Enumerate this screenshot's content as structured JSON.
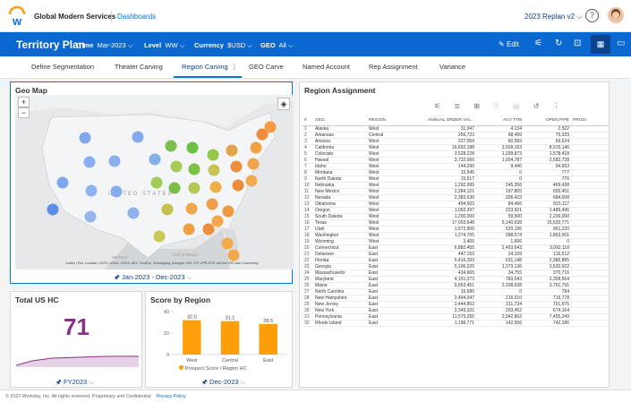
{
  "top": {
    "company": "Global Modern Services",
    "nav_link": "Dashboards",
    "plan": "2023 Replan v2",
    "help": "?"
  },
  "header": {
    "title": "Territory Plan",
    "filters": [
      {
        "label": "Time",
        "value": "Mar-2023"
      },
      {
        "label": "Level",
        "value": "WW"
      },
      {
        "label": "Currency",
        "value": "$USD"
      },
      {
        "label": "GEO",
        "value": "All"
      }
    ],
    "edit": "Edit"
  },
  "tabs": [
    "Define Segmentation",
    "Theater Carving",
    "Region Carving",
    "GEO Carve",
    "Named Account",
    "Rep Assignment",
    "Variance"
  ],
  "active_tab": "Region Carving",
  "geo_map": {
    "title": "Geo Map",
    "labels": {
      "country": "UNITED STATES",
      "mexico": "MEXICO",
      "gulf": "Gulf of Mexico"
    },
    "attribution": "Leaflet | Esri, Location, USGS, USDA, USGS, AEX, GeoEye, Getmapping, Aerogrid, IGN, IGP, UPR-EGP, and the GIS User Community",
    "period": "Jan-2023 - Dec-2023",
    "zoom_in": "+",
    "zoom_out": "−"
  },
  "total_hc": {
    "title": "Total US HC",
    "value": "71",
    "period": "FY2023"
  },
  "score": {
    "title": "Score by Region",
    "period": "Dec-2023"
  },
  "region_assignment": {
    "title": "Region Assignment",
    "columns": [
      "#",
      "GEO",
      "REGION",
      "ANNUAL ORDER VAL...",
      "ACV TTM",
      "OPEN PIPE",
      "PROSI"
    ],
    "rows": [
      [
        "1",
        "Alaska",
        "West",
        "31,947",
        "4,134",
        "2,522"
      ],
      [
        "2",
        "Arkansas",
        "Central",
        "256,723",
        "68,499",
        "75,329"
      ],
      [
        "3",
        "Arizona",
        "West",
        "227,059",
        "60,583",
        "66,624"
      ],
      [
        "4",
        "California",
        "West",
        "16,692,188",
        "3,509,153",
        "8,915,146"
      ],
      [
        "5",
        "Colorado",
        "West",
        "3,528,228",
        "1,299,873",
        "1,578,418"
      ],
      [
        "6",
        "Hawaii",
        "West",
        "3,732,066",
        "1,004,787",
        "2,582,738"
      ],
      [
        "7",
        "Idaho",
        "West",
        "144,290",
        "9,440",
        "94,663"
      ],
      [
        "8",
        "Montana",
        "West",
        "15,545",
        "0",
        "777"
      ],
      [
        "9",
        "North Dakota",
        "West",
        "15,517",
        "0",
        "776"
      ],
      [
        "10",
        "Nebraska",
        "West",
        "1,292,995",
        "245,356",
        "469,438"
      ],
      [
        "11",
        "New Mexico",
        "West",
        "2,284,121",
        "197,805",
        "655,451"
      ],
      [
        "12",
        "Nevada",
        "West",
        "2,383,636",
        "206,423",
        "684,008"
      ],
      [
        "13",
        "Oklahoma",
        "West",
        "494,503",
        "84,466",
        "815,117"
      ],
      [
        "14",
        "Oregon",
        "West",
        "1,092,297",
        "223,921",
        "1,489,496"
      ],
      [
        "15",
        "South Dakota",
        "West",
        "1,200,000",
        "59,500",
        "2,200,000"
      ],
      [
        "16",
        "Texas",
        "West",
        "17,003,648",
        "5,140,638",
        "15,520,771"
      ],
      [
        "17",
        "Utah",
        "West",
        "1,572,905",
        "520,195",
        "961,220"
      ],
      [
        "18",
        "Washington",
        "West",
        "1,274,705",
        "288,574",
        "1,863,001"
      ],
      [
        "19",
        "Wyoming",
        "West",
        "3,405",
        "1,666",
        "0"
      ],
      [
        "20",
        "Connecticut",
        "East",
        "6,882,455",
        "2,493,643",
        "3,092,118"
      ],
      [
        "21",
        "Delaware",
        "East",
        "447,153",
        "24,109",
        "116,512"
      ],
      [
        "22",
        "Florida",
        "East",
        "5,416,393",
        "631,148",
        "2,386,885"
      ],
      [
        "23",
        "Georgia",
        "East",
        "5,100,220",
        "1,373,136",
        "3,530,922"
      ],
      [
        "24",
        "Massachusetts",
        "East",
        "434,665",
        "34,755",
        "370,716"
      ],
      [
        "25",
        "Maryland",
        "East",
        "4,151,073",
        "783,043",
        "2,358,564"
      ],
      [
        "26",
        "Maine",
        "East",
        "9,953,451",
        "2,938,638",
        "3,791,791"
      ],
      [
        "27",
        "North Carolina",
        "East",
        "15,680",
        "0",
        "784"
      ],
      [
        "28",
        "New Hampshire",
        "East",
        "2,494,347",
        "216,010",
        "715,778"
      ],
      [
        "29",
        "New Jersey",
        "East",
        "2,444,852",
        "211,724",
        "701,575"
      ],
      [
        "30",
        "New York",
        "East",
        "2,349,331",
        "203,452",
        "674,164"
      ],
      [
        "31",
        "Pennsylvania",
        "East",
        "11,575,255",
        "2,942,862",
        "7,455,249"
      ],
      [
        "32",
        "Rhode Island",
        "East",
        "1,196,771",
        "142,556",
        "742,186"
      ]
    ]
  },
  "chart_data": {
    "type": "bar",
    "title": "Score by Region",
    "categories": [
      "West",
      "Central",
      "East"
    ],
    "values": [
      32.0,
      31.1,
      28.5
    ],
    "data_labels": [
      "32.0",
      "31.1",
      "28.5"
    ],
    "ylabel": "",
    "ylim": [
      0,
      40
    ],
    "yticks": [
      "0",
      "20",
      "40"
    ],
    "legend": [
      {
        "name": "Prospect Score / Region HC",
        "color": "#ff9e0b"
      }
    ],
    "color": "#ff9e0b"
  },
  "footer": {
    "copyright": "© 2022 Workday, Inc. All rights reserved. Proprietary and Confidential",
    "privacy": "Privacy Policy"
  }
}
